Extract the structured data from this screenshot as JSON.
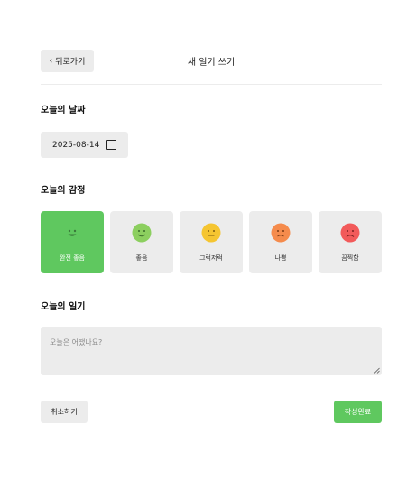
{
  "header": {
    "back_label": "뒤로가기",
    "title": "새 일기 쓰기"
  },
  "date_section": {
    "label": "오늘의 날짜",
    "value": "2025-08-14"
  },
  "mood_section": {
    "label": "오늘의 감정",
    "options": [
      {
        "label": "완전 좋음",
        "face": "big-smile",
        "color": "#ffffff",
        "selected": true
      },
      {
        "label": "좋음",
        "face": "smile",
        "color": "#8ccf5f",
        "selected": false
      },
      {
        "label": "그럭저럭",
        "face": "neutral",
        "color": "#f5c531",
        "selected": false
      },
      {
        "label": "나쁨",
        "face": "frown",
        "color": "#f58b4c",
        "selected": false
      },
      {
        "label": "끔찍함",
        "face": "sad",
        "color": "#f25a5a",
        "selected": false
      }
    ],
    "selected_color": "#5fc85f"
  },
  "diary_section": {
    "label": "오늘의 일기",
    "placeholder": "오늘은 어땠나요?",
    "value": ""
  },
  "footer": {
    "cancel_label": "취소하기",
    "done_label": "작성완료"
  },
  "colors": {
    "accent": "#5fc85f",
    "surface": "#ececec"
  }
}
